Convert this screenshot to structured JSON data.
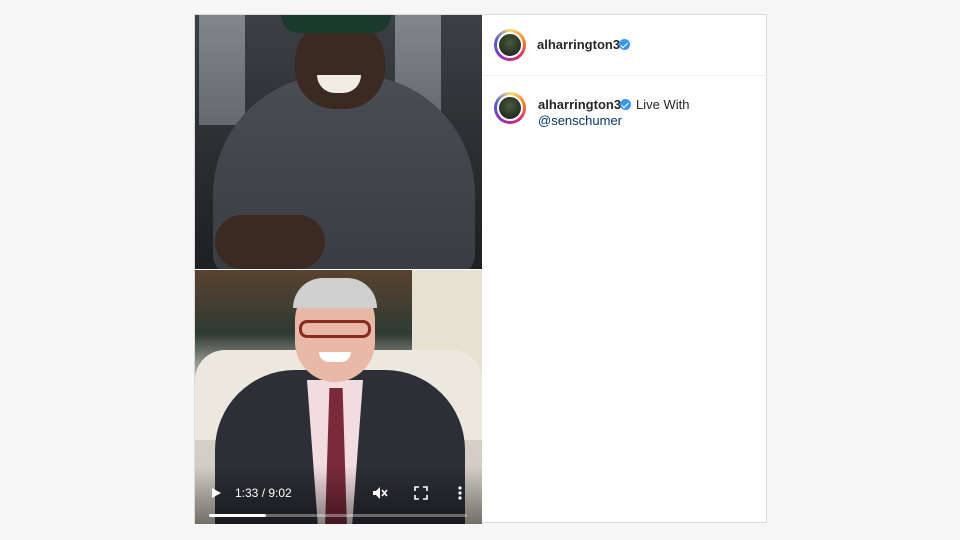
{
  "post": {
    "author": {
      "username": "alharrington3",
      "verified": true
    },
    "caption": {
      "text": "Live With",
      "mention": "@senschumer"
    }
  },
  "video": {
    "time_display": "1:33 / 9:02",
    "progress_fraction": 0.22,
    "icons": {
      "play": "play-icon",
      "mute": "muted-speaker-icon",
      "fullscreen": "fullscreen-icon",
      "more": "more-vertical-icon"
    }
  },
  "colors": {
    "verified_badge": "#3897f0",
    "mention_link": "#00376b",
    "text": "#262626",
    "border": "#dbdbdb"
  }
}
